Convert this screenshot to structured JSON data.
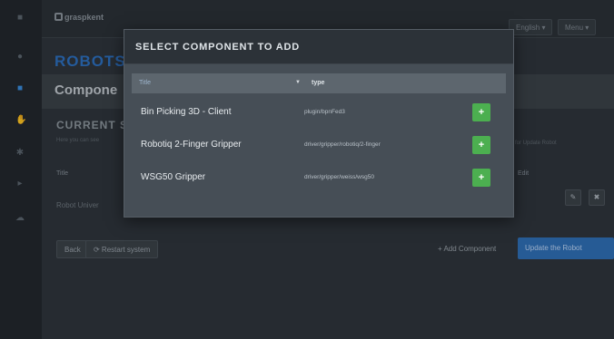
{
  "rail": {
    "icons": [
      "dashboard-icon",
      "robot-icon",
      "grid-icon",
      "grasp-icon",
      "settings-icon",
      "camera-icon",
      "cloud-icon"
    ]
  },
  "header": {
    "logo": "graspkent",
    "language": "English ▾",
    "menu": "Menu ▾"
  },
  "page": {
    "title": "ROBOTS",
    "strip_title": "Compone",
    "section_title": "CURRENT S",
    "section_desc": "Here you can see",
    "section_desc_right": "for Update Robot",
    "table": {
      "col_title": "Title",
      "col_edit": "Edit",
      "row_title": "Robot Univer"
    },
    "buttons": {
      "back": "Back",
      "restart": "⟳ Restart system",
      "add_component": "+ Add Component",
      "update_robot": "Update the Robot"
    }
  },
  "modal": {
    "title": "SELECT COMPONENT TO ADD",
    "columns": {
      "title": "Title",
      "type": "type"
    },
    "rows": [
      {
        "title": "Bin Picking 3D - Client",
        "type": "plugin/bpnFed3"
      },
      {
        "title": "Robotiq 2-Finger Gripper",
        "type": "driver/gripper/robotiq/2-finger"
      },
      {
        "title": "WSG50 Gripper",
        "type": "driver/gripper/weiss/wsg50"
      }
    ]
  },
  "colors": {
    "accent_blue": "#2d6fbf",
    "add_green": "#4caf50",
    "modal_header": "#2c3238"
  }
}
